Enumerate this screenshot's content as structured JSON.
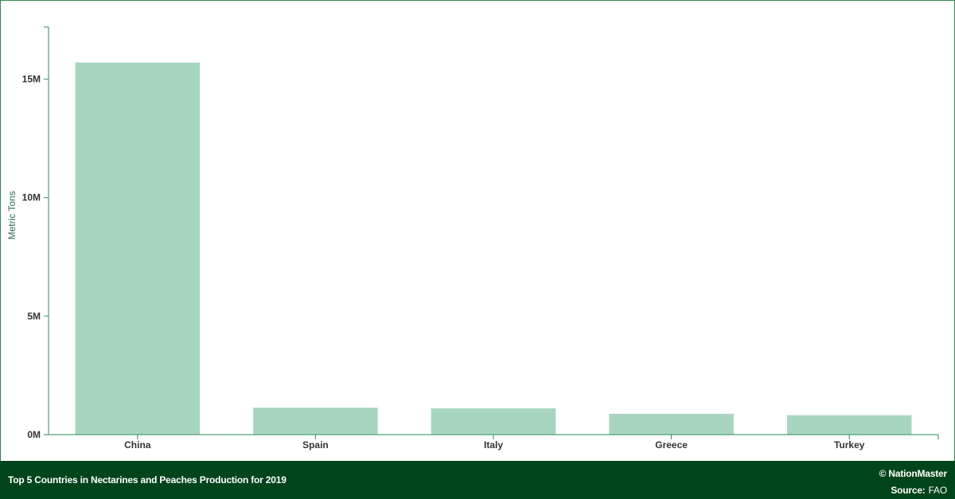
{
  "footer": {
    "title": "Top 5 Countries in Nectarines and Peaches Production for 2019",
    "copyright": "© NationMaster",
    "source_label": "Source:",
    "source_value": "FAO"
  },
  "colors": {
    "bar": "#a8d5c0",
    "axis": "#2e8b57",
    "footer_bg": "#00441b"
  },
  "chart_data": {
    "type": "bar",
    "ylabel": "Metric Tons",
    "xlabel": "",
    "categories": [
      "China",
      "Spain",
      "Italy",
      "Greece",
      "Turkey"
    ],
    "values": [
      15700000,
      1140000,
      1110000,
      880000,
      820000
    ],
    "yticks": [
      0,
      5000000,
      10000000,
      15000000
    ],
    "ytick_labels": [
      "0M",
      "5M",
      "10M",
      "15M"
    ],
    "ylim": [
      0,
      17200000
    ],
    "grid": false
  }
}
